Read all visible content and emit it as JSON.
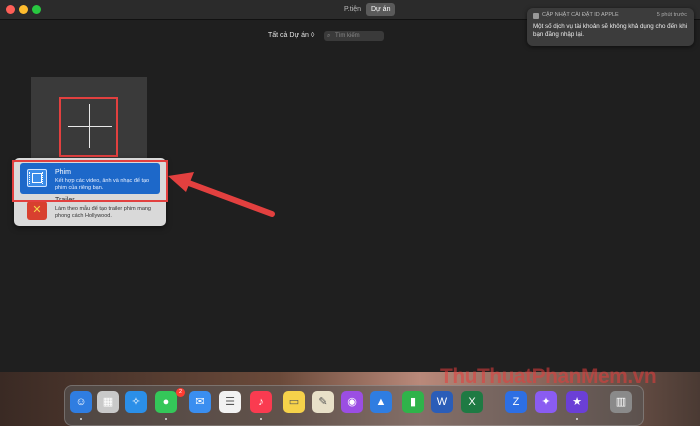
{
  "titlebar": {
    "tabs": [
      {
        "label": "P.tiện",
        "active": false
      },
      {
        "label": "Dự án",
        "active": true
      }
    ]
  },
  "toolbar": {
    "filter_label": "Tất cả Dự án ◊",
    "search_placeholder": "Tìm kiếm"
  },
  "menu": {
    "items": [
      {
        "title": "Phim",
        "description": "Kết hợp các video, ảnh và nhạc để tạo phim của riêng bạn.",
        "icon": "film-icon",
        "selected": true
      },
      {
        "title": "Trailer",
        "description": "Làm theo mẫu để tạo trailer phim mang phong cách Hollywood.",
        "icon": "trailer-icon",
        "selected": false
      }
    ]
  },
  "notification": {
    "app": "CẬP NHẬT CÀI ĐẶT ID APPLE",
    "time": "5 phút trước",
    "body": "Một số dịch vụ tài khoản sẽ không khả dụng cho đến khi bạn đăng nhập lại."
  },
  "dock": {
    "messages_badge": "2",
    "icons": [
      {
        "name": "finder-icon",
        "glyph": "☺",
        "color": "#2f7de1"
      },
      {
        "name": "launchpad-icon",
        "glyph": "▦",
        "color": "#c9c9c9"
      },
      {
        "name": "safari-icon",
        "glyph": "✧",
        "color": "#2b8fe8"
      },
      {
        "name": "messages-icon",
        "glyph": "●",
        "color": "#34c759"
      },
      {
        "name": "mail-icon",
        "glyph": "✉",
        "color": "#3a8ef0"
      },
      {
        "name": "reminders-icon",
        "glyph": "☰",
        "color": "#f2f2f2"
      },
      {
        "name": "music-icon",
        "glyph": "♪",
        "color": "#fa3b50"
      },
      {
        "name": "notes-icon",
        "glyph": "▭",
        "color": "#f6d24a"
      },
      {
        "name": "script-editor-icon",
        "glyph": "✎",
        "color": "#e8e0c8"
      },
      {
        "name": "podcasts-icon",
        "glyph": "◉",
        "color": "#9b4ee3"
      },
      {
        "name": "keynote-icon",
        "glyph": "▲",
        "color": "#2f7de1"
      },
      {
        "name": "numbers-icon",
        "glyph": "▮",
        "color": "#2fb34a"
      },
      {
        "name": "word-icon",
        "glyph": "W",
        "color": "#2b5db8"
      },
      {
        "name": "excel-icon",
        "glyph": "X",
        "color": "#1f7a43"
      },
      {
        "name": "zalo-icon",
        "glyph": "Z",
        "color": "#2d6fe4"
      },
      {
        "name": "messenger-icon",
        "glyph": "✦",
        "color": "#8a5cf2"
      },
      {
        "name": "imovie-icon",
        "glyph": "★",
        "color": "#6b3fd6"
      },
      {
        "name": "trash-icon",
        "glyph": "▥",
        "color": "#8a8a8a"
      }
    ]
  },
  "watermark": "ThuThuatPhanMem.vn"
}
